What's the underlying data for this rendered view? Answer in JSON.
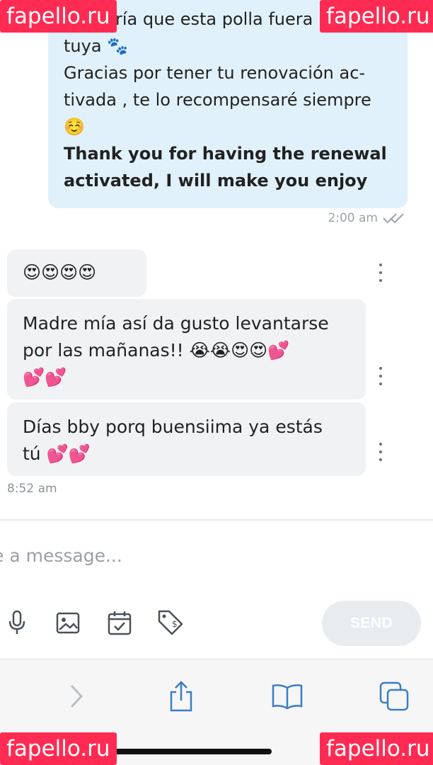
{
  "messages": {
    "outgoing": {
      "lines": [
        "Me haría que esta polla fuera mía",
        "tuya 🐾",
        "Gracias por tener tu renovación ac-",
        "tivada , te lo recompensaré siempre",
        "☺️"
      ],
      "bold_lines": [
        "Thank you for having the renewal",
        "activated, I will make you enjoy"
      ],
      "time": "2:00 am",
      "read_icon": "double-check-icon"
    },
    "incoming": [
      {
        "lines": [
          "😍😍😍😍"
        ]
      },
      {
        "lines": [
          "Madre mía así da gusto levantarse",
          "por las mañanas!! 😭😭😍😍💕",
          "💕💕"
        ]
      },
      {
        "lines": [
          "Días bby porq buensiima ya estás",
          "tú 💕💕"
        ]
      }
    ],
    "incoming_time": "8:52 am"
  },
  "composer": {
    "placeholder": "Type a message...",
    "tools": [
      "microphone-icon",
      "image-icon",
      "calendar-icon",
      "price-tag-icon"
    ],
    "send_label": "SEND"
  },
  "browser": {
    "buttons": [
      "forward-icon",
      "share-icon",
      "bookmarks-icon",
      "tabs-icon"
    ]
  },
  "watermark": "fapello.ru",
  "colors": {
    "outgoing_bubble": "#e1f1fb",
    "incoming_bubble": "#f1f2f4",
    "watermark": "#ff2b52",
    "icon": "#3b7dc4"
  }
}
